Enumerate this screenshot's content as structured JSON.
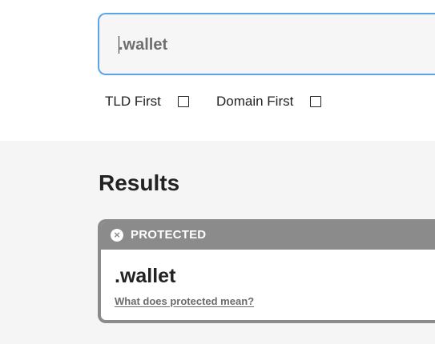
{
  "search": {
    "value": ".wallet",
    "placeholder": ".wallet"
  },
  "options": {
    "tld_first_label": "TLD First",
    "domain_first_label": "Domain First"
  },
  "results": {
    "title": "Results",
    "items": [
      {
        "status": "PROTECTED",
        "domain": ".wallet",
        "link_label": "What does protected mean?"
      }
    ]
  },
  "colors": {
    "accent_border": "#58a6e8",
    "status_gray": "#8c8b8b",
    "page_background": "#f5f5f5"
  },
  "icons": {
    "status_icon": "close-icon"
  }
}
